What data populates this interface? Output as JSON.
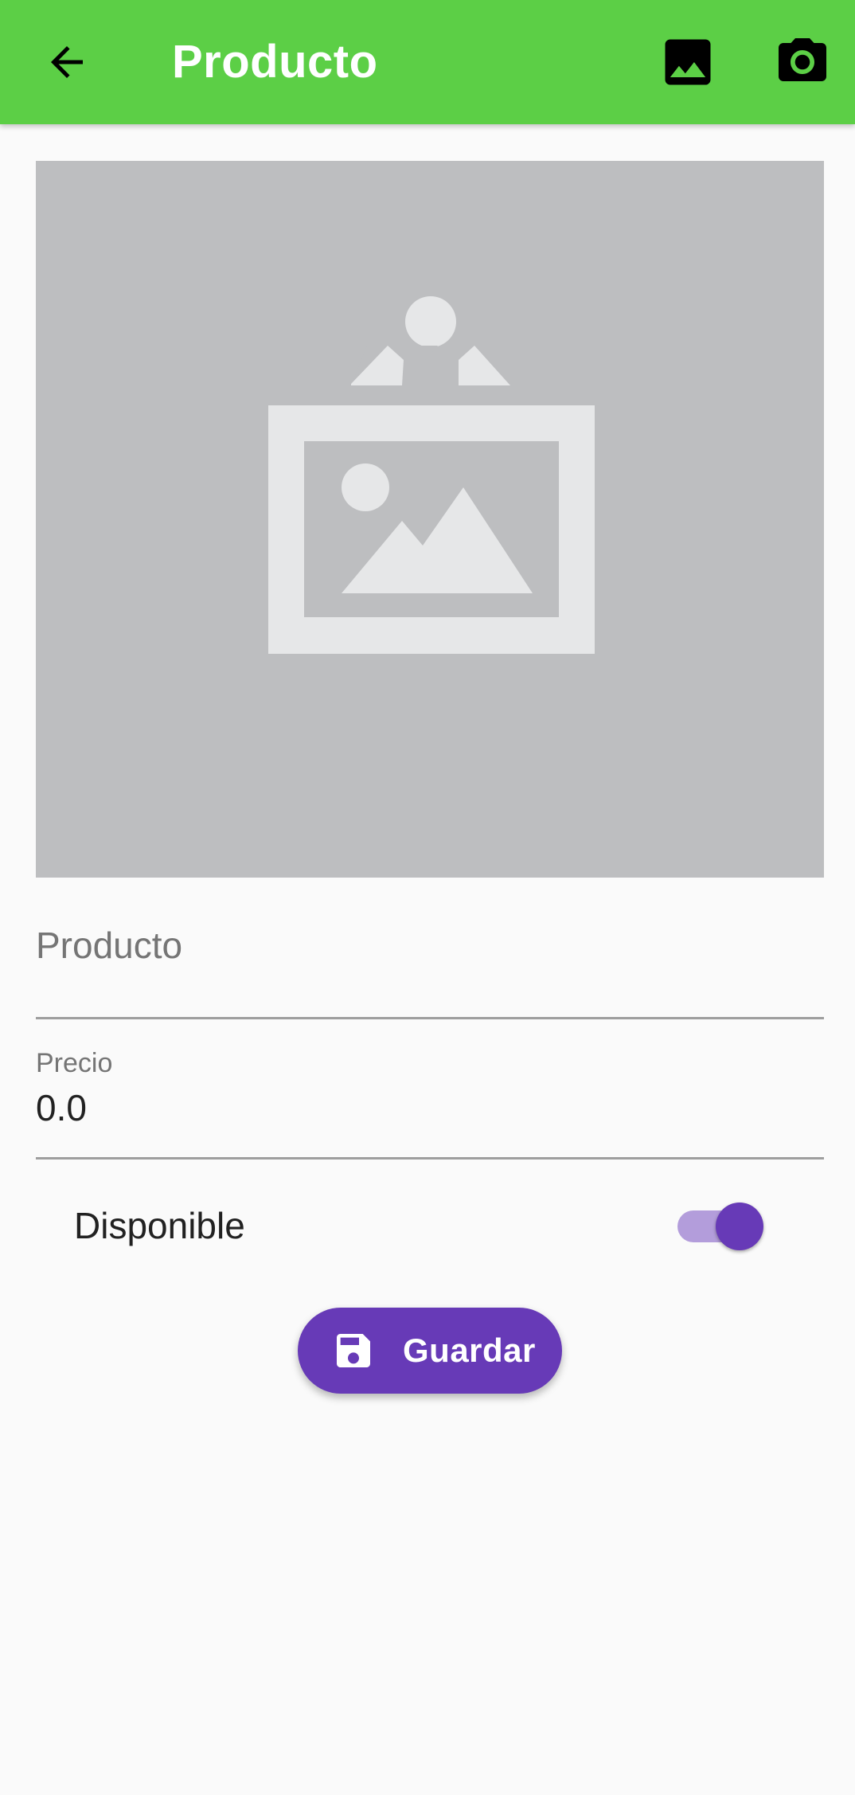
{
  "colors": {
    "appbar": "#5ccf46",
    "appbar_icons": "#000000",
    "accent": "#673ab7",
    "accent_light": "#b39ddb",
    "placeholder_bg": "#bdbec0",
    "placeholder_fg": "#e6e7e8"
  },
  "appbar": {
    "title": "Producto",
    "back_icon": "arrow-back-icon",
    "gallery_icon": "photo-icon",
    "camera_icon": "camera-icon"
  },
  "image": {
    "icon": "image-placeholder-icon"
  },
  "form": {
    "producto": {
      "placeholder": "Producto",
      "value": ""
    },
    "precio": {
      "label": "Precio",
      "value": "0.0"
    },
    "disponible": {
      "label": "Disponible",
      "checked": true
    }
  },
  "save_button": {
    "label": "Guardar",
    "icon": "save-icon"
  }
}
